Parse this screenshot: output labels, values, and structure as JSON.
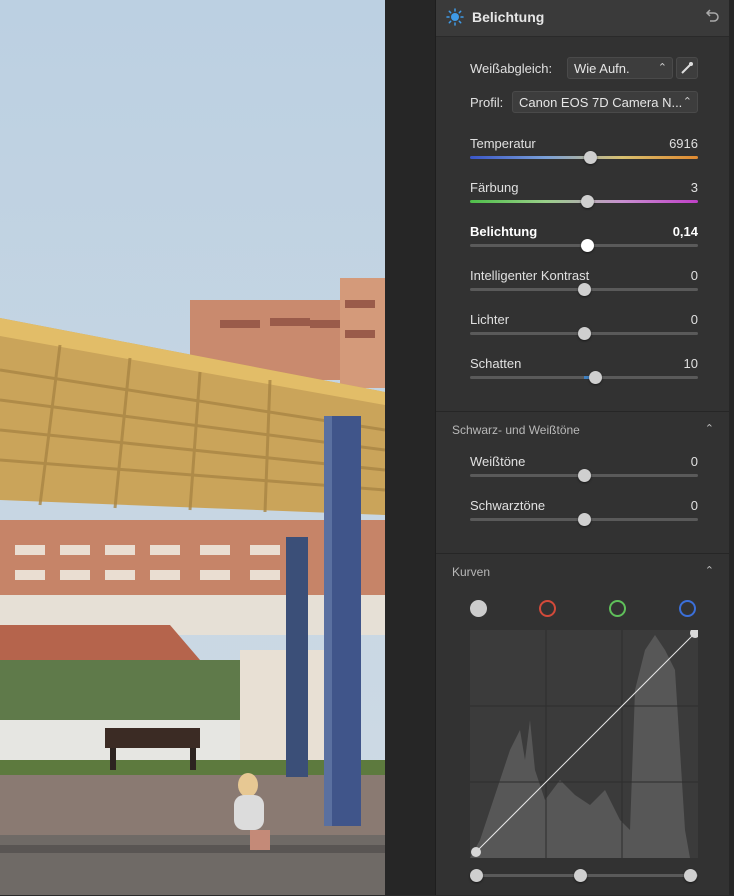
{
  "panel": {
    "title": "Belichtung",
    "white_balance": {
      "label": "Weißabgleich:",
      "value": "Wie Aufn."
    },
    "profile": {
      "label": "Profil:",
      "value": "Canon EOS 7D Camera N..."
    },
    "sliders": [
      {
        "label": "Temperatur",
        "value": "6916",
        "pos": 0.525
      },
      {
        "label": "Färbung",
        "value": "3",
        "pos": 0.515
      },
      {
        "label": "Belichtung",
        "value": "0,14",
        "pos": 0.515
      },
      {
        "label": "Intelligenter Kontrast",
        "value": "0",
        "pos": 0.5
      },
      {
        "label": "Lichter",
        "value": "0",
        "pos": 0.5
      },
      {
        "label": "Schatten",
        "value": "10",
        "pos": 0.55
      }
    ],
    "bw_section": {
      "title": "Schwarz- und Weißtöne",
      "sliders": [
        {
          "label": "Weißtöne",
          "value": "0",
          "pos": 0.5
        },
        {
          "label": "Schwarztöne",
          "value": "0",
          "pos": 0.5
        }
      ]
    },
    "curves_section": {
      "title": "Kurven"
    }
  },
  "colors": {
    "panel_bg": "#323232",
    "accent_blue": "#3f7fbf",
    "red_channel": "#d24a3a",
    "green_channel": "#5fbf5a",
    "blue_channel": "#3b6fd8"
  }
}
